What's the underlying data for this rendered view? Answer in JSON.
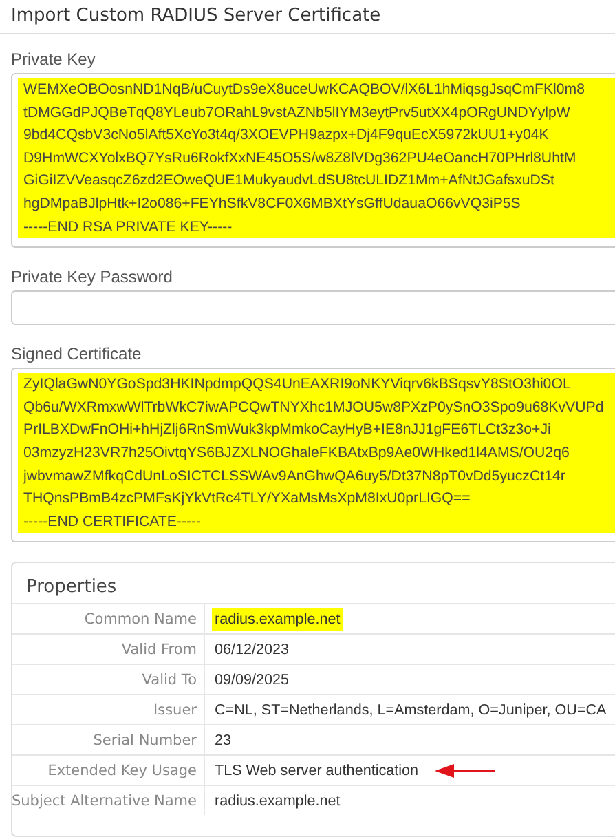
{
  "title": "Import Custom RADIUS Server Certificate",
  "private_key": {
    "label": "Private Key",
    "highlighted": true,
    "lines": [
      "WEMXeOBOosnND1NqB/uCuytDs9eX8uceUwKCAQBOV/lX6L1hMiqsgJsqCmFKl0m8",
      "tDMGGdPJQBeTqQ8YLeub7ORahL9vstAZNb5lIYM3eytPrv5utXX4pORgUNDYylpW",
      "9bd4CQsbV3cNo5lAft5XcYo3t4q/3XOEVPH9azpx+Dj4F9quEcX5972kUU1+y04K",
      "D9HmWCXYolxBQ7YsRu6RokfXxNE45O5S/w8Z8lVDg362PU4eOancH70PHrl8UhtM",
      "GiGiIZVVeasqcZ6zd2EOweQUE1MukyaudvLdSU8tcULIDZ1Mm+AfNtJGafsxuDSt",
      "hgDMpaBJlpHtk+I2o086+FEYhSfkV8CF0X6MBXtYsGffUdauaO66vVQ3iP5S",
      "-----END RSA PRIVATE KEY-----"
    ]
  },
  "password": {
    "label": "Private Key Password"
  },
  "certificate": {
    "label": "Signed Certificate",
    "highlighted": true,
    "lines": [
      "ZyIQlaGwN0YGoSpd3HKINpdmpQQS4UnEAXRI9oNKYViqrv6kBSqsvY8StO3hi0OL",
      "Qb6u/WXRmxwWlTrbWkC7iwAPCQwTNYXhc1MJOU5w8PXzP0ySnO3Spo9u68KvVUPd",
      "PrILBXDwFnOHi+hHjZlj6RnSmWuk3kpMmkoCayHyB+IE8nJJ1gFE6TLCt3z3o+Ji",
      "03mzyzH23VR7h25OivtqYS6BJZXLNOGhaleFKBAtxBp9Ae0WHked1l4AMS/OU2q6",
      "jwbvmawZMfkqCdUnLoSICTCLSSWAv9AnGhwQA6uy5/Dt37N8pT0vDd5yuczCt14r",
      "THQnsPBmB4zcPMFsKjYkVtRc4TLY/YXaMsMsXpM8IxU0prLIGQ==",
      "-----END CERTIFICATE-----"
    ]
  },
  "properties": {
    "title": "Properties",
    "rows": [
      {
        "label": "Common Name",
        "value": "radius.example.net",
        "highlighted": true,
        "arrow": false
      },
      {
        "label": "Valid From",
        "value": "06/12/2023",
        "highlighted": false,
        "arrow": false
      },
      {
        "label": "Valid To",
        "value": "09/09/2025",
        "highlighted": false,
        "arrow": false
      },
      {
        "label": "Issuer",
        "value": "C=NL, ST=Netherlands, L=Amsterdam, O=Juniper, OU=CA",
        "highlighted": false,
        "arrow": false
      },
      {
        "label": "Serial Number",
        "value": "23",
        "highlighted": false,
        "arrow": false
      },
      {
        "label": "Extended Key Usage",
        "value": "TLS Web server authentication",
        "highlighted": false,
        "arrow": true
      },
      {
        "label": "Subject Alternative Name",
        "value": "radius.example.net",
        "highlighted": false,
        "arrow": false
      }
    ]
  }
}
